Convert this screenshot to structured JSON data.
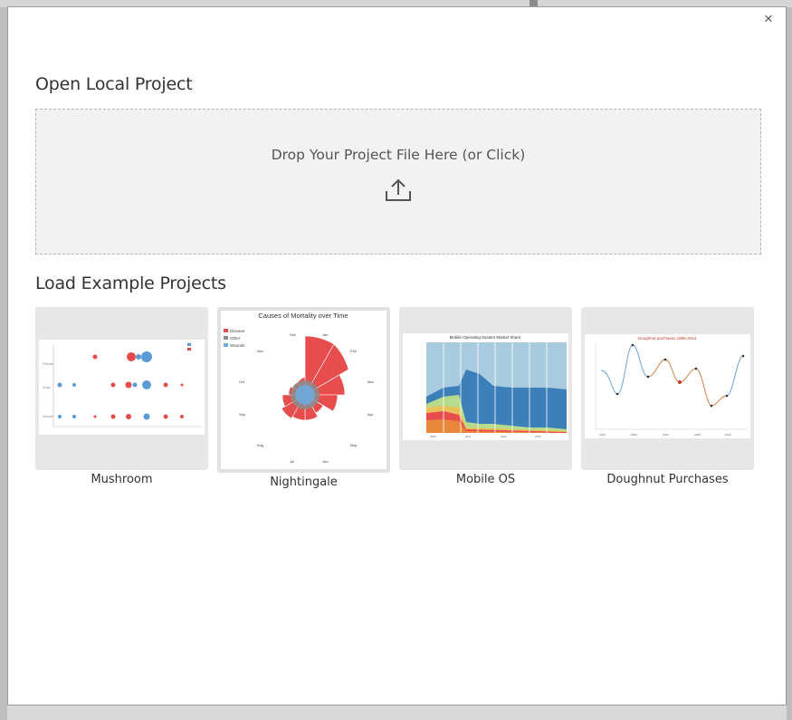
{
  "dialog": {
    "close_label": "×",
    "open_section_title": "Open Local Project",
    "dropzone_text": "Drop Your Project File Here (or Click)",
    "upload_icon": "upload-icon",
    "examples_section_title": "Load Example Projects"
  },
  "examples": [
    {
      "label": "Mushroom",
      "thumb": {
        "legend": [
          "Edible",
          "Poisonous"
        ],
        "rows": [
          "Fibrous",
          "Scaly",
          "Smooth"
        ],
        "cols": [
          "Almond",
          "Anise",
          "Creosote",
          "Fishy",
          "Foul",
          "Musty",
          "None",
          "Pungent",
          "Spicy"
        ]
      },
      "colors": {
        "blue": "#5b9bd5",
        "red": "#e84a4a"
      }
    },
    {
      "label": "Nightingale",
      "selected": true,
      "thumb": {
        "title": "Causes of Mortality over Time",
        "legend": [
          "Disease",
          "Other",
          "Wounds"
        ],
        "months": [
          "Dec",
          "Jan",
          "Feb",
          "Mar",
          "Apr",
          "May",
          "Jun",
          "Jul",
          "Aug",
          "Sep",
          "Oct",
          "Nov"
        ]
      },
      "colors": {
        "disease": "#e84d4d",
        "other": "#8c8c8c",
        "wounds": "#6fa8dc"
      }
    },
    {
      "label": "Mobile OS",
      "thumb": {
        "title": "Mobile Operating System Market Share",
        "years": [
          "2009",
          "2010",
          "2011",
          "2012",
          "2013",
          "2014",
          "2015",
          "2016"
        ]
      },
      "colors": {
        "ios_light": "#a9cbe0",
        "android": "#3d7fb8",
        "green": "#b6db8c"
      }
    },
    {
      "label": "Doughnut Purchases",
      "thumb": {
        "title": "Doughnut purchases 1996-2014",
        "years": [
          "1996",
          "1998",
          "2000",
          "2002",
          "2004",
          "2006",
          "2008",
          "2010",
          "2012",
          "2014"
        ]
      },
      "colors": {
        "line_blue": "#5b9bd5",
        "line_orange": "#e8873a",
        "point": "#c0392b"
      }
    }
  ]
}
